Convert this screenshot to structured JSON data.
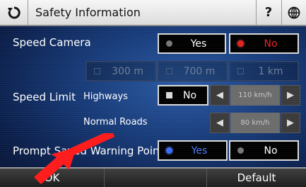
{
  "header": {
    "title": "Safety Information",
    "back_icon": "refresh-back-icon",
    "help_label": "?",
    "globe_icon": "globe-icon"
  },
  "speed_camera": {
    "label": "Speed Camera",
    "yes": "Yes",
    "no": "No",
    "selected": "No",
    "distances": [
      "300 m",
      "700 m",
      "1 km"
    ]
  },
  "speed_limit": {
    "label": "Speed Limit",
    "highways_label": "Highways",
    "highways_value": "No",
    "highways_speed": "110 km/h",
    "normal_roads_label": "Normal Roads",
    "normal_roads_speed": "80 km/h"
  },
  "prompt_saved": {
    "label": "Prompt Saved Warning Point",
    "yes": "Yes",
    "no": "No",
    "selected": "Yes"
  },
  "bottom": {
    "ok_label": "OK",
    "default_label": "Default"
  },
  "colors": {
    "selected_red": "#e0221f",
    "selected_blue": "#3a6cff",
    "annotation_arrow": "#ff1a1a"
  }
}
